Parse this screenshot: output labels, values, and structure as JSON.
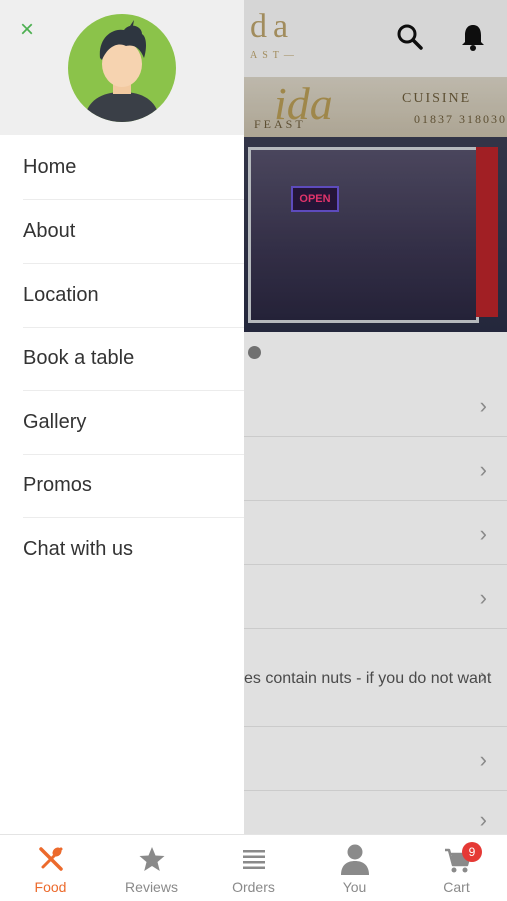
{
  "header": {
    "logo_main": "da",
    "logo_sub": "AST—"
  },
  "hero": {
    "sign_main": "ida",
    "sign_cuisine": "CUISINE",
    "sign_feast": "FEAST",
    "sign_phone": "01837 318030",
    "open_sign": "OPEN"
  },
  "menu": {
    "partial_text": "es contain nuts - if you do not want"
  },
  "drawer": {
    "items": [
      {
        "label": "Home"
      },
      {
        "label": "About"
      },
      {
        "label": "Location"
      },
      {
        "label": "Book a table"
      },
      {
        "label": "Gallery"
      },
      {
        "label": "Promos"
      },
      {
        "label": "Chat with us"
      }
    ]
  },
  "tabs": [
    {
      "label": "Food",
      "icon": "cutlery-icon",
      "active": true
    },
    {
      "label": "Reviews",
      "icon": "star-icon"
    },
    {
      "label": "Orders",
      "icon": "list-icon"
    },
    {
      "label": "You",
      "icon": "person-icon"
    },
    {
      "label": "Cart",
      "icon": "cart-icon",
      "badge": "9"
    }
  ],
  "colors": {
    "accent": "#ec6a2c",
    "close_icon": "#4caf50",
    "avatar_bg": "#8bc34a",
    "badge": "#e53935"
  }
}
